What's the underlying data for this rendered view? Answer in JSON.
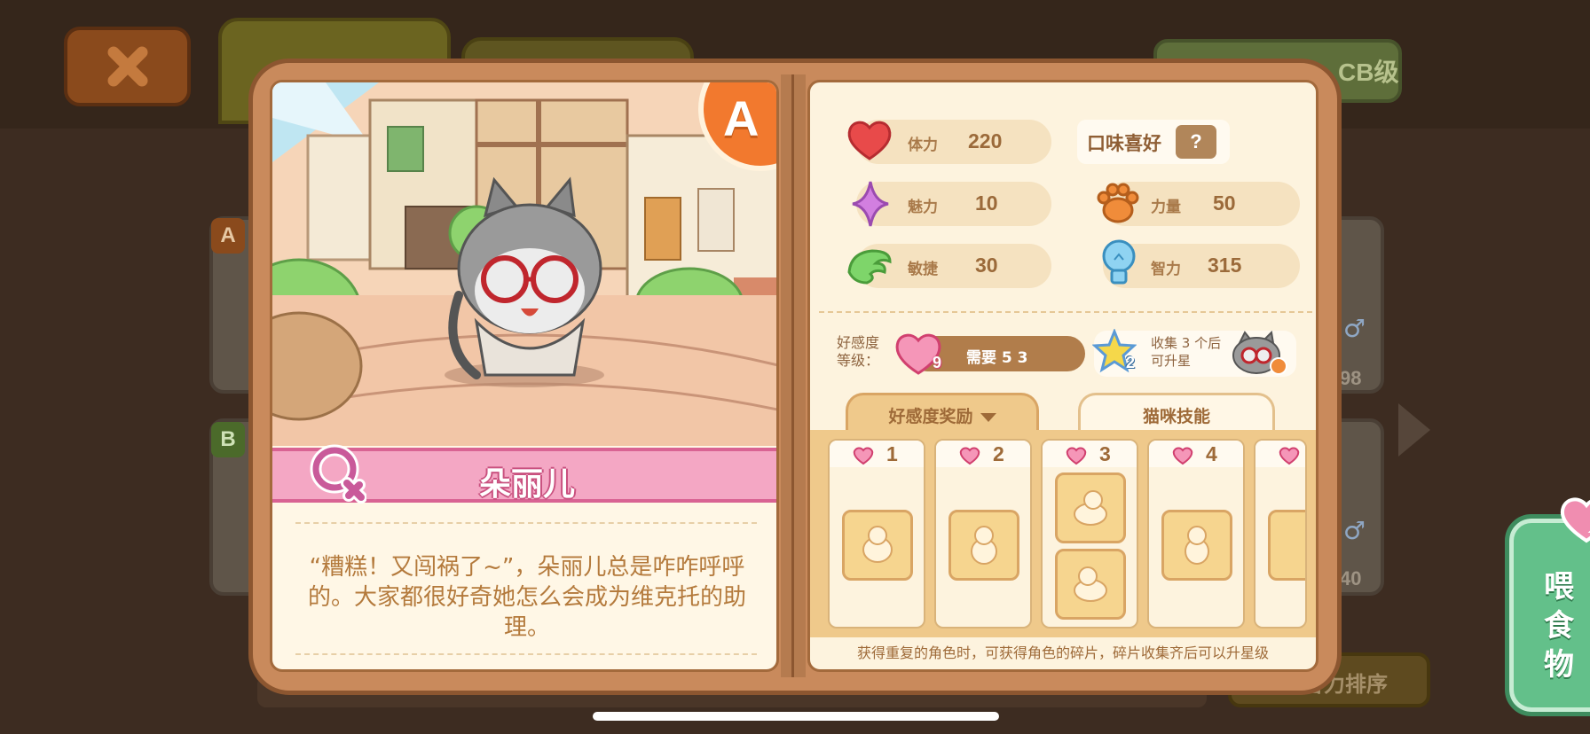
{
  "background": {
    "grade_filter_label": "CB级",
    "sort_label": "智力排序",
    "card_numbers": [
      "98",
      "40"
    ],
    "card_grades": [
      "A",
      "B"
    ]
  },
  "character": {
    "grade": "A",
    "name": "朵丽儿",
    "gender": "female",
    "description": "“糟糕！又闯祸了~”，朵丽儿总是咋咋呼呼的。大家都很好奇她怎么会成为维克托的助理。"
  },
  "stats": {
    "stamina": {
      "label": "体力",
      "value": "220"
    },
    "charm": {
      "label": "魅力",
      "value": "10"
    },
    "agility": {
      "label": "敏捷",
      "value": "30"
    },
    "strength": {
      "label": "力量",
      "value": "50"
    },
    "intelligence": {
      "label": "智力",
      "value": "315"
    },
    "taste_label": "口味喜好",
    "taste_value": "?"
  },
  "affection": {
    "label": "好感度等级：",
    "level": "9",
    "bar_text": "需要 5 3",
    "collect_count": "2",
    "collect_text": "收集 3 个后可升星"
  },
  "tabs": {
    "reward": "好感度奖励",
    "skill": "猫咪技能"
  },
  "rewards": [
    "1",
    "2",
    "3",
    "4"
  ],
  "footer_note": "获得重复的角色时，可获得角色的碎片，碎片收集齐后可以升星级",
  "feed_button": "喂食物",
  "colors": {
    "accent_orange": "#f2792e",
    "name_pink": "#f4a7c4",
    "feed_green": "#63c08a"
  }
}
